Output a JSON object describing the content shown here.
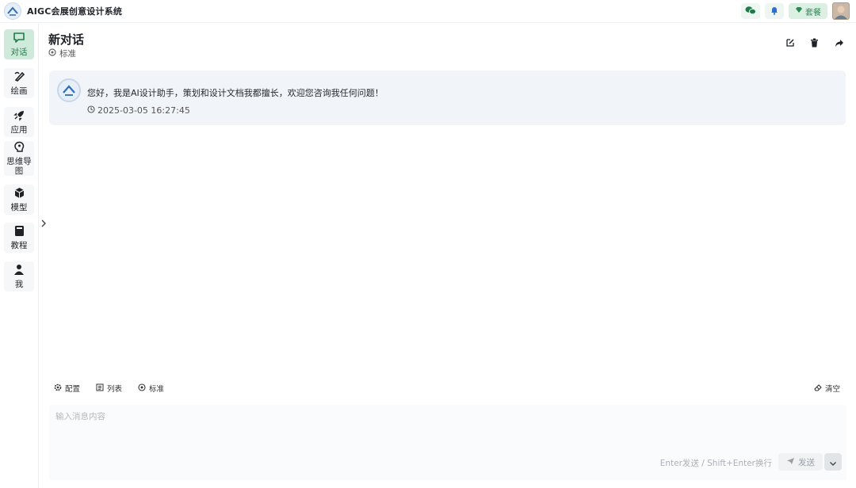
{
  "app": {
    "title": "AIGC会展创意设计系统"
  },
  "topbar": {
    "plan_label": "套餐"
  },
  "sidebar": {
    "items": [
      {
        "label": "对话",
        "icon": "chat-icon",
        "active": true
      },
      {
        "label": "绘画",
        "icon": "brush-icon",
        "active": false
      },
      {
        "label": "应用",
        "icon": "rocket-icon",
        "active": false
      },
      {
        "label": "思维导图",
        "icon": "mindmap-icon",
        "active": false
      },
      {
        "label": "模型",
        "icon": "cube-icon",
        "active": false
      },
      {
        "label": "教程",
        "icon": "book-icon",
        "active": false
      },
      {
        "label": "我",
        "icon": "user-icon",
        "active": false
      }
    ]
  },
  "chat": {
    "title": "新对话",
    "mode": "标准",
    "messages": [
      {
        "text": "您好，我是AI设计助手，策划和设计文档我都擅长，欢迎您咨询我任何问题！",
        "time": "2025-03-05 16:27:45"
      }
    ]
  },
  "composer": {
    "tools": [
      {
        "label": "配置",
        "icon": "gear-icon"
      },
      {
        "label": "列表",
        "icon": "list-icon"
      },
      {
        "label": "标准",
        "icon": "mode-icon"
      }
    ],
    "clear_label": "清空",
    "placeholder": "输入消息内容",
    "hint": "Enter发送 / Shift+Enter换行",
    "send_label": "发送"
  },
  "colors": {
    "accent": "#1f7a4a",
    "active_bg": "#cfeadb",
    "message_bg": "#f1f4f8"
  }
}
